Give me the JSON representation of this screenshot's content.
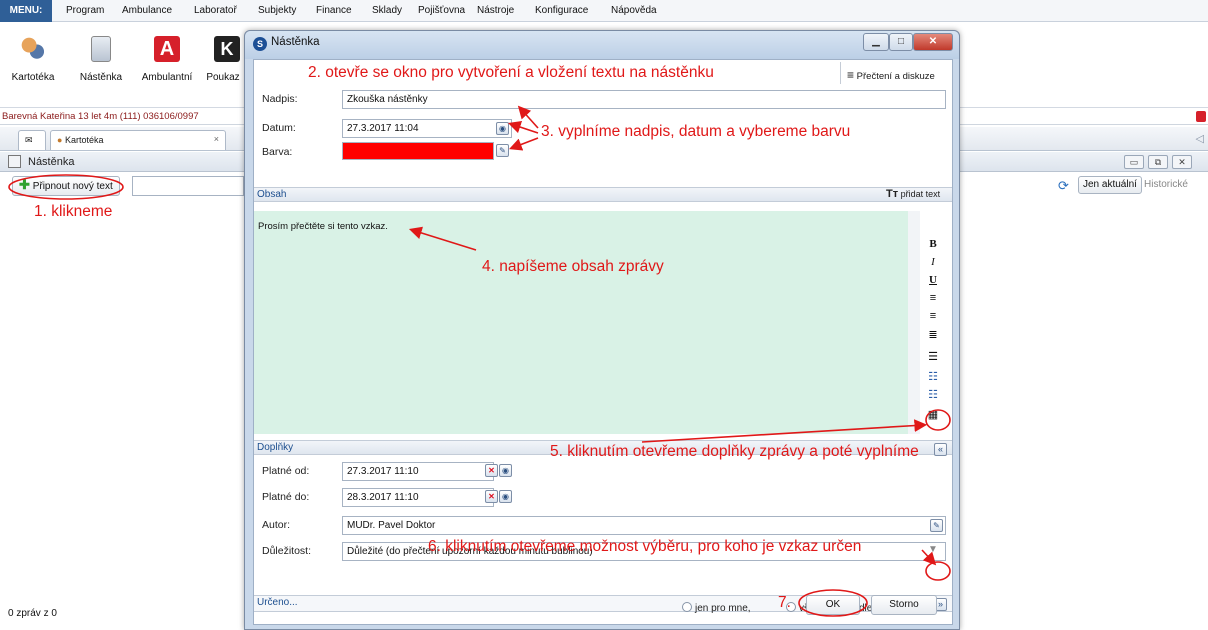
{
  "menu": {
    "items": [
      "MENU:",
      "Program",
      "Ambulance",
      "Laboratoř",
      "Subjekty",
      "Finance",
      "Sklady",
      "Pojišťovna",
      "Nástroje",
      "Konfigurace",
      "Nápověda"
    ]
  },
  "toolbar": {
    "buttons": [
      {
        "label": "Kartotéka",
        "icon": "people-icon"
      },
      {
        "label": "Nástěnka",
        "icon": "clipboard-icon"
      },
      {
        "label": "Ambulantní",
        "icon": "ambulance-card-icon"
      },
      {
        "label": "Poukaz",
        "icon": "voucher-icon"
      }
    ]
  },
  "patient": {
    "text": "Barevná Kateřina 13 let 4m (111) 036106/0997"
  },
  "tabs": [
    {
      "label": "",
      "icon": "close-x-icon"
    },
    {
      "label": "Kartotéka",
      "icon": "people-icon"
    }
  ],
  "subhead": {
    "title": "Nástěnka"
  },
  "actionbar": {
    "pin_button": "Připnout nový text",
    "only_current": "Jen aktuální",
    "historic": "Historické"
  },
  "status": {
    "count": "0 zpráv z 0"
  },
  "dialog": {
    "title": "Nástěnka",
    "read_discuss": "Přečtení a diskuze",
    "fields": {
      "nadpis_label": "Nadpis:",
      "nadpis_value": "Zkouška nástěnky",
      "datum_label": "Datum:",
      "datum_value": "27.3.2017 11:04",
      "barva_label": "Barva:",
      "barva_value": "#ff0000"
    },
    "obsah": {
      "header": "Obsah",
      "add_text": "přidat text",
      "text": "Prosím přečtěte si tento vzkaz."
    },
    "doplnky": {
      "header": "Doplňky",
      "platne_od_label": "Platné od:",
      "platne_od_value": "27.3.2017 11:10",
      "platne_do_label": "Platné do:",
      "platne_do_value": "28.3.2017 11:10",
      "autor_label": "Autor:",
      "autor_value": "MUDr. Pavel Doktor",
      "dulezitost_label": "Důležitost:",
      "dulezitost_value": "Důležité (do přečtení upozorní každou minutu bublinou)"
    },
    "urceno": {
      "header": "Určeno...",
      "options": [
        "jen pro mne,",
        "všem,",
        "dle výběru"
      ],
      "selected": "dle výběru"
    },
    "ok": "OK",
    "cancel": "Storno"
  },
  "annotations": {
    "a1": "1. klikneme",
    "a2": "2. otevře se okno pro vytvoření a vložení textu na nástěnku",
    "a3": "3. vyplníme nadpis, datum a vybereme barvu",
    "a4": "4. napíšeme obsah zprávy",
    "a5": "5. kliknutím otevřeme doplňky zprávy a poté vyplníme",
    "a6": "6. kliknutím otevřeme možnost výběru, pro koho je vzkaz určen",
    "a7": "7."
  },
  "colors": {
    "annotation": "#e01818",
    "accent": "#2f5f97",
    "content_bg": "#d9f2e6"
  }
}
